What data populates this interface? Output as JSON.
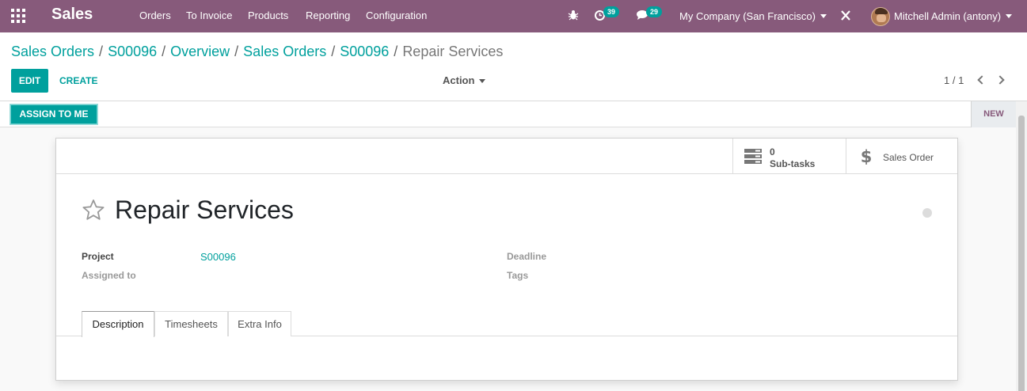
{
  "navbar": {
    "brand": "Sales",
    "menu": [
      "Orders",
      "To Invoice",
      "Products",
      "Reporting",
      "Configuration"
    ],
    "activity_count": "39",
    "messages_count": "29",
    "company": "My Company (San Francisco)",
    "user": "Mitchell Admin (antony)"
  },
  "breadcrumb": [
    "Sales Orders",
    "S00096",
    "Overview",
    "Sales Orders",
    "S00096"
  ],
  "breadcrumb_active": "Repair Services",
  "breadcrumb_sep": "/",
  "control": {
    "edit_label": "EDIT",
    "create_label": "CREATE",
    "action_label": "Action",
    "pager": "1 / 1"
  },
  "status": {
    "assign_label": "ASSIGN TO ME",
    "stage": "NEW"
  },
  "smart_buttons": {
    "subtasks_count": "0",
    "subtasks_label": "Sub-tasks",
    "sales_order_label": "Sales Order"
  },
  "form": {
    "title": "Repair Services",
    "project_label": "Project",
    "project_value": "S00096",
    "assigned_label": "Assigned to",
    "deadline_label": "Deadline",
    "tags_label": "Tags"
  },
  "tabs": [
    "Description",
    "Timesheets",
    "Extra Info"
  ],
  "colors": {
    "primary": "#875a7b",
    "accent": "#00a09d"
  }
}
